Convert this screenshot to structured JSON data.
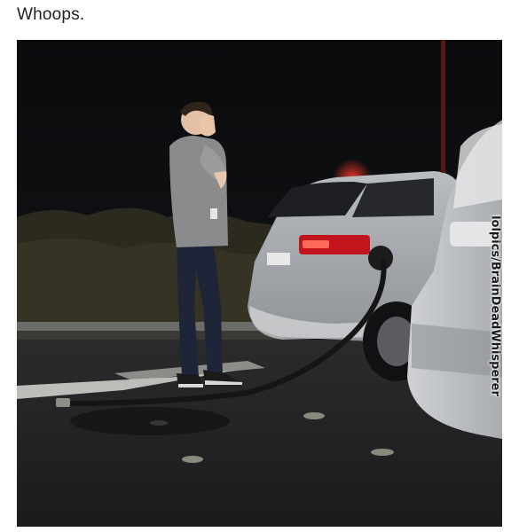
{
  "post": {
    "caption": "Whoops."
  },
  "photo": {
    "watermark": "lolpics/BrainDeadWhisperer",
    "scene": {
      "person": "man-with-hands-over-face",
      "vehicles": [
        "silver-hatchback",
        "white-suv"
      ],
      "object": "detached-fuel-hose"
    }
  }
}
